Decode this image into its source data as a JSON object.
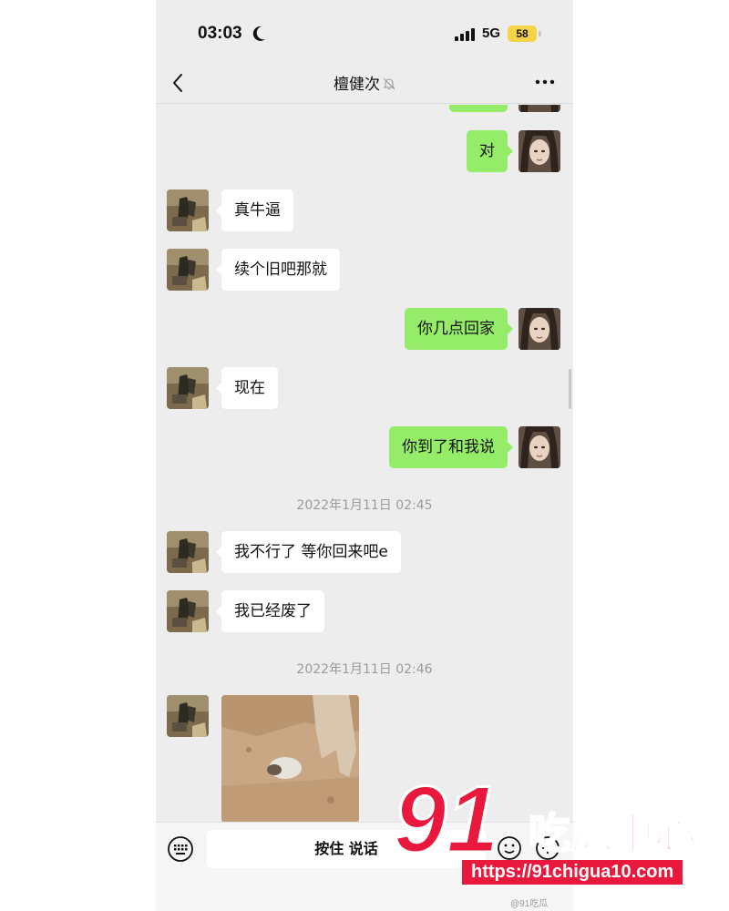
{
  "status_bar": {
    "time": "03:03",
    "network": "5G",
    "battery": "58"
  },
  "header": {
    "chat_title": "檀健次"
  },
  "messages": [
    {
      "side": "right",
      "text": "对"
    },
    {
      "side": "left",
      "text": "真牛逼"
    },
    {
      "side": "left",
      "text": "续个旧吧那就"
    },
    {
      "side": "right",
      "text": "你几点回家"
    },
    {
      "side": "left",
      "text": "现在"
    },
    {
      "side": "right",
      "text": "你到了和我说"
    },
    {
      "side": "left",
      "text": "我不行了 等你回来吧e"
    },
    {
      "side": "left",
      "text": "我已经废了"
    }
  ],
  "timestamps": [
    "2022年1月11日 02:45",
    "2022年1月11日 02:46"
  ],
  "input": {
    "voice_label": "按住 说话"
  },
  "watermark": {
    "logo_number": "91",
    "logo_text": "吃瓜中心",
    "url": "https://91chigua10.com",
    "weibo": "@91吃瓜"
  },
  "colors": {
    "sent_bubble": "#95ec69",
    "received_bubble": "#ffffff",
    "chat_background": "#ededed",
    "watermark_red": "#e8193c"
  },
  "icons": [
    "moon-icon",
    "signal-icon",
    "back-icon",
    "mute-bell-icon",
    "more-icon",
    "keyboard-icon",
    "emoji-icon",
    "plus-icon"
  ]
}
